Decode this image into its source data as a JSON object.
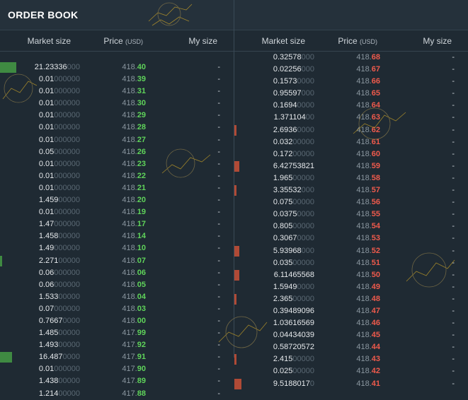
{
  "panel": {
    "title": "ORDER BOOK"
  },
  "columns": {
    "market_size": "Market size",
    "price": "Price",
    "price_unit": "(USD)",
    "my_size": "My size"
  },
  "colors": {
    "bid": "#5fd35a",
    "ask": "#ee5a4c",
    "background": "#1f2a33"
  },
  "bids": [
    {
      "size": "21.23336",
      "pad": "000",
      "base": "418.",
      "tail": "40",
      "my": "-",
      "depth": 0.07
    },
    {
      "size": "0.01",
      "pad": "000000",
      "base": "418.",
      "tail": "39",
      "my": "-",
      "depth": 0
    },
    {
      "size": "0.01",
      "pad": "000000",
      "base": "418.",
      "tail": "31",
      "my": "-",
      "depth": 0
    },
    {
      "size": "0.01",
      "pad": "000000",
      "base": "418.",
      "tail": "30",
      "my": "-",
      "depth": 0
    },
    {
      "size": "0.01",
      "pad": "000000",
      "base": "418.",
      "tail": "29",
      "my": "-",
      "depth": 0
    },
    {
      "size": "0.01",
      "pad": "000000",
      "base": "418.",
      "tail": "28",
      "my": "-",
      "depth": 0
    },
    {
      "size": "0.01",
      "pad": "000000",
      "base": "418.",
      "tail": "27",
      "my": "-",
      "depth": 0
    },
    {
      "size": "0.05",
      "pad": "000000",
      "base": "418.",
      "tail": "26",
      "my": "-",
      "depth": 0
    },
    {
      "size": "0.01",
      "pad": "000000",
      "base": "418.",
      "tail": "23",
      "my": "-",
      "depth": 0
    },
    {
      "size": "0.01",
      "pad": "000000",
      "base": "418.",
      "tail": "22",
      "my": "-",
      "depth": 0
    },
    {
      "size": "0.01",
      "pad": "000000",
      "base": "418.",
      "tail": "21",
      "my": "-",
      "depth": 0
    },
    {
      "size": "1.459",
      "pad": "00000",
      "base": "418.",
      "tail": "20",
      "my": "-",
      "depth": 0
    },
    {
      "size": "0.01",
      "pad": "000000",
      "base": "418.",
      "tail": "19",
      "my": "-",
      "depth": 0
    },
    {
      "size": "1.47",
      "pad": "000000",
      "base": "418.",
      "tail": "17",
      "my": "-",
      "depth": 0
    },
    {
      "size": "1.458",
      "pad": "00000",
      "base": "418.",
      "tail": "14",
      "my": "-",
      "depth": 0
    },
    {
      "size": "1.49",
      "pad": "000000",
      "base": "418.",
      "tail": "10",
      "my": "-",
      "depth": 0
    },
    {
      "size": "2.271",
      "pad": "00000",
      "base": "418.",
      "tail": "07",
      "my": "-",
      "depth": 0.01
    },
    {
      "size": "0.06",
      "pad": "000000",
      "base": "418.",
      "tail": "06",
      "my": "-",
      "depth": 0
    },
    {
      "size": "0.06",
      "pad": "000000",
      "base": "418.",
      "tail": "05",
      "my": "-",
      "depth": 0
    },
    {
      "size": "1.533",
      "pad": "00000",
      "base": "418.",
      "tail": "04",
      "my": "-",
      "depth": 0
    },
    {
      "size": "0.07",
      "pad": "000000",
      "base": "418.",
      "tail": "03",
      "my": "-",
      "depth": 0
    },
    {
      "size": "0.7667",
      "pad": "0000",
      "base": "418.",
      "tail": "00",
      "my": "-",
      "depth": 0
    },
    {
      "size": "1.485",
      "pad": "00000",
      "base": "417.",
      "tail": "99",
      "my": "-",
      "depth": 0
    },
    {
      "size": "1.493",
      "pad": "00000",
      "base": "417.",
      "tail": "92",
      "my": "-",
      "depth": 0
    },
    {
      "size": "16.487",
      "pad": "0000",
      "base": "417.",
      "tail": "91",
      "my": "-",
      "depth": 0.05
    },
    {
      "size": "0.01",
      "pad": "000000",
      "base": "417.",
      "tail": "90",
      "my": "-",
      "depth": 0
    },
    {
      "size": "1.438",
      "pad": "00000",
      "base": "417.",
      "tail": "89",
      "my": "-",
      "depth": 0
    },
    {
      "size": "1.214",
      "pad": "00000",
      "base": "417.",
      "tail": "88",
      "my": "-",
      "depth": 0
    }
  ],
  "asks": [
    {
      "size": "0.32578",
      "pad": "000",
      "base": "418.",
      "tail": "68",
      "my": "-",
      "depth": 0
    },
    {
      "size": "0.02256",
      "pad": "000",
      "base": "418.",
      "tail": "67",
      "my": "-",
      "depth": 0
    },
    {
      "size": "0.1573",
      "pad": "0000",
      "base": "418.",
      "tail": "66",
      "my": "-",
      "depth": 0
    },
    {
      "size": "0.95597",
      "pad": "000",
      "base": "418.",
      "tail": "65",
      "my": "-",
      "depth": 0
    },
    {
      "size": "0.1694",
      "pad": "0000",
      "base": "418.",
      "tail": "64",
      "my": "-",
      "depth": 0
    },
    {
      "size": "1.371104",
      "pad": "00",
      "base": "418.",
      "tail": "63",
      "my": "-",
      "depth": 0
    },
    {
      "size": "2.6936",
      "pad": "0000",
      "base": "418.",
      "tail": "62",
      "my": "-",
      "depth": 0.01
    },
    {
      "size": "0.032",
      "pad": "00000",
      "base": "418.",
      "tail": "61",
      "my": "-",
      "depth": 0
    },
    {
      "size": "0.172",
      "pad": "00000",
      "base": "418.",
      "tail": "60",
      "my": "-",
      "depth": 0
    },
    {
      "size": "6.42753821",
      "pad": "",
      "base": "418.",
      "tail": "59",
      "my": "-",
      "depth": 0.02
    },
    {
      "size": "1.965",
      "pad": "00000",
      "base": "418.",
      "tail": "58",
      "my": "-",
      "depth": 0
    },
    {
      "size": "3.35532",
      "pad": "000",
      "base": "418.",
      "tail": "57",
      "my": "-",
      "depth": 0.01
    },
    {
      "size": "0.075",
      "pad": "00000",
      "base": "418.",
      "tail": "56",
      "my": "-",
      "depth": 0
    },
    {
      "size": "0.0375",
      "pad": "0000",
      "base": "418.",
      "tail": "55",
      "my": "-",
      "depth": 0
    },
    {
      "size": "0.805",
      "pad": "00000",
      "base": "418.",
      "tail": "54",
      "my": "-",
      "depth": 0
    },
    {
      "size": "0.3067",
      "pad": "0000",
      "base": "418.",
      "tail": "53",
      "my": "-",
      "depth": 0
    },
    {
      "size": "5.93968",
      "pad": "000",
      "base": "418.",
      "tail": "52",
      "my": "-",
      "depth": 0.02
    },
    {
      "size": "0.035",
      "pad": "00000",
      "base": "418.",
      "tail": "51",
      "my": "-",
      "depth": 0
    },
    {
      "size": "6.11465568",
      "pad": "",
      "base": "418.",
      "tail": "50",
      "my": "-",
      "depth": 0.02
    },
    {
      "size": "1.5949",
      "pad": "0000",
      "base": "418.",
      "tail": "49",
      "my": "-",
      "depth": 0
    },
    {
      "size": "2.365",
      "pad": "00000",
      "base": "418.",
      "tail": "48",
      "my": "-",
      "depth": 0.01
    },
    {
      "size": "0.39489096",
      "pad": "",
      "base": "418.",
      "tail": "47",
      "my": "-",
      "depth": 0
    },
    {
      "size": "1.03616569",
      "pad": "",
      "base": "418.",
      "tail": "46",
      "my": "-",
      "depth": 0
    },
    {
      "size": "0.04434039",
      "pad": "",
      "base": "418.",
      "tail": "45",
      "my": "-",
      "depth": 0
    },
    {
      "size": "0.58720572",
      "pad": "",
      "base": "418.",
      "tail": "44",
      "my": "-",
      "depth": 0
    },
    {
      "size": "2.415",
      "pad": "00000",
      "base": "418.",
      "tail": "43",
      "my": "-",
      "depth": 0.01
    },
    {
      "size": "0.025",
      "pad": "00000",
      "base": "418.",
      "tail": "42",
      "my": "-",
      "depth": 0
    },
    {
      "size": "9.5188017",
      "pad": "0",
      "base": "418.",
      "tail": "41",
      "my": "-",
      "depth": 0.03
    }
  ]
}
